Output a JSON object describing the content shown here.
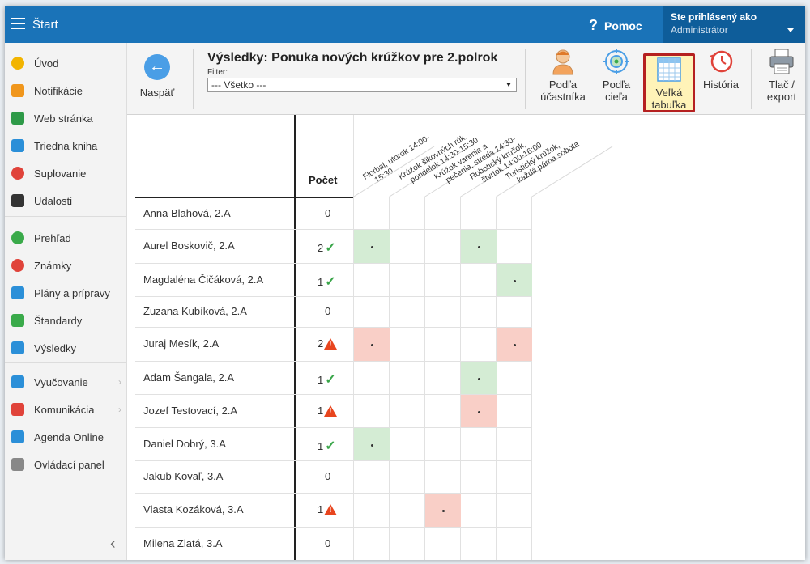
{
  "topbar": {
    "title": "Štart",
    "help_label": "Pomoc",
    "help_glyph": "?",
    "user_line1": "Ste prihlásený ako",
    "user_line2": "Administrátor"
  },
  "sidebar": {
    "collapse_glyph": "‹",
    "items": [
      {
        "label": "Úvod",
        "icon": "star-icon",
        "color": "#f2b400"
      },
      {
        "label": "Notifikácie",
        "icon": "envelope-icon",
        "color": "#f0961c"
      },
      {
        "label": "Web stránka",
        "icon": "home-icon",
        "color": "#2e9a48"
      },
      {
        "label": "Triedna kniha",
        "icon": "book-icon",
        "color": "#2b8fd8"
      },
      {
        "label": "Suplovanie",
        "icon": "substitute-icon",
        "color": "#e0433a"
      },
      {
        "label": "Udalosti",
        "icon": "calendar-icon",
        "color": "#333333"
      },
      {
        "label": "Prehľad",
        "icon": "check-circle-icon",
        "color": "#3aaa4a"
      },
      {
        "label": "Známky",
        "icon": "grade-icon",
        "color": "#e0433a"
      },
      {
        "label": "Plány a prípravy",
        "icon": "briefcase-icon",
        "color": "#2b8fd8"
      },
      {
        "label": "Štandardy",
        "icon": "shield-icon",
        "color": "#3aaa4a"
      },
      {
        "label": "Výsledky",
        "icon": "bar-chart-icon",
        "color": "#2b8fd8"
      },
      {
        "label": "Vyučovanie",
        "icon": "teaching-icon",
        "color": "#2b8fd8"
      },
      {
        "label": "Komunikácia",
        "icon": "chat-icon",
        "color": "#e0433a"
      },
      {
        "label": "Agenda Online",
        "icon": "pen-icon",
        "color": "#2b8fd8"
      },
      {
        "label": "Ovládací panel",
        "icon": "gear-icon",
        "color": "#888888"
      }
    ]
  },
  "toolbar": {
    "back_label": "Naspäť",
    "back_glyph": "←",
    "title": "Výsledky: Ponuka nových krúžkov pre 2.polrok",
    "filter_label": "Filter:",
    "filter_value": "--- Všetko ---",
    "tools": [
      {
        "label": "Podľa účastníka",
        "line1": "Podľa",
        "line2": "účastníka",
        "icon": "person-icon",
        "active": false
      },
      {
        "label": "Podľa cieľa",
        "line1": "Podľa",
        "line2": "cieľa",
        "icon": "target-icon",
        "active": false
      },
      {
        "label": "Veľká tabuľka",
        "line1": "Veľká",
        "line2": "tabuľka",
        "icon": "table-icon",
        "active": true
      },
      {
        "label": "História",
        "line1": "História",
        "line2": "",
        "icon": "history-icon",
        "active": false
      },
      {
        "label": "Tlač / export",
        "line1": "Tlač /",
        "line2": "export",
        "icon": "printer-icon",
        "active": false
      }
    ]
  },
  "grid": {
    "count_header": "Počet",
    "columns": [
      {
        "line1": "Florbal, utorok 14:00-",
        "line2": "15:30"
      },
      {
        "line1": "Krúžok šikovných rúk,",
        "line2": "pondelok 14:30-15:30"
      },
      {
        "line1": "Krúžok varenia a",
        "line2": "pečenia, streda 14:30-"
      },
      {
        "line1": "Robotický krúžok,",
        "line2": "štvrtok 14:00-16:00"
      },
      {
        "line1": "Turistický krúžok,",
        "line2": "každá párna sobota"
      }
    ],
    "rows": [
      {
        "name": "Anna Blahová, 2.A",
        "count": "0",
        "status": "none",
        "cells": [
          "",
          "",
          "",
          "",
          ""
        ]
      },
      {
        "name": "Aurel Boskovič, 2.A",
        "count": "2",
        "status": "ok",
        "cells": [
          "ok",
          "",
          "",
          "ok",
          ""
        ]
      },
      {
        "name": "Magdaléna Čičáková, 2.A",
        "count": "1",
        "status": "ok",
        "cells": [
          "",
          "",
          "",
          "",
          "ok"
        ]
      },
      {
        "name": "Zuzana Kubíková, 2.A",
        "count": "0",
        "status": "none",
        "cells": [
          "",
          "",
          "",
          "",
          ""
        ]
      },
      {
        "name": "Juraj Mesík, 2.A",
        "count": "2",
        "status": "warn",
        "cells": [
          "bad",
          "",
          "",
          "",
          "bad"
        ]
      },
      {
        "name": "Adam Šangala, 2.A",
        "count": "1",
        "status": "ok",
        "cells": [
          "",
          "",
          "",
          "ok",
          ""
        ]
      },
      {
        "name": "Jozef Testovací, 2.A",
        "count": "1",
        "status": "warn",
        "cells": [
          "",
          "",
          "",
          "bad",
          ""
        ]
      },
      {
        "name": "Daniel Dobrý, 3.A",
        "count": "1",
        "status": "ok",
        "cells": [
          "ok",
          "",
          "",
          "",
          ""
        ]
      },
      {
        "name": "Jakub Kovaľ, 3.A",
        "count": "0",
        "status": "none",
        "cells": [
          "",
          "",
          "",
          "",
          ""
        ]
      },
      {
        "name": "Vlasta Kozáková, 3.A",
        "count": "1",
        "status": "warn",
        "cells": [
          "",
          "",
          "bad",
          "",
          ""
        ]
      },
      {
        "name": "Milena Zlatá, 3.A",
        "count": "0",
        "status": "none",
        "cells": [
          "",
          "",
          "",
          "",
          ""
        ]
      }
    ]
  },
  "colors": {
    "topbar": "#1a73b8",
    "ok_cell": "#d4ecd4",
    "bad_cell": "#f9cfc7",
    "active_tool_border": "#b52020",
    "active_tool_bg": "#fff3b8"
  }
}
